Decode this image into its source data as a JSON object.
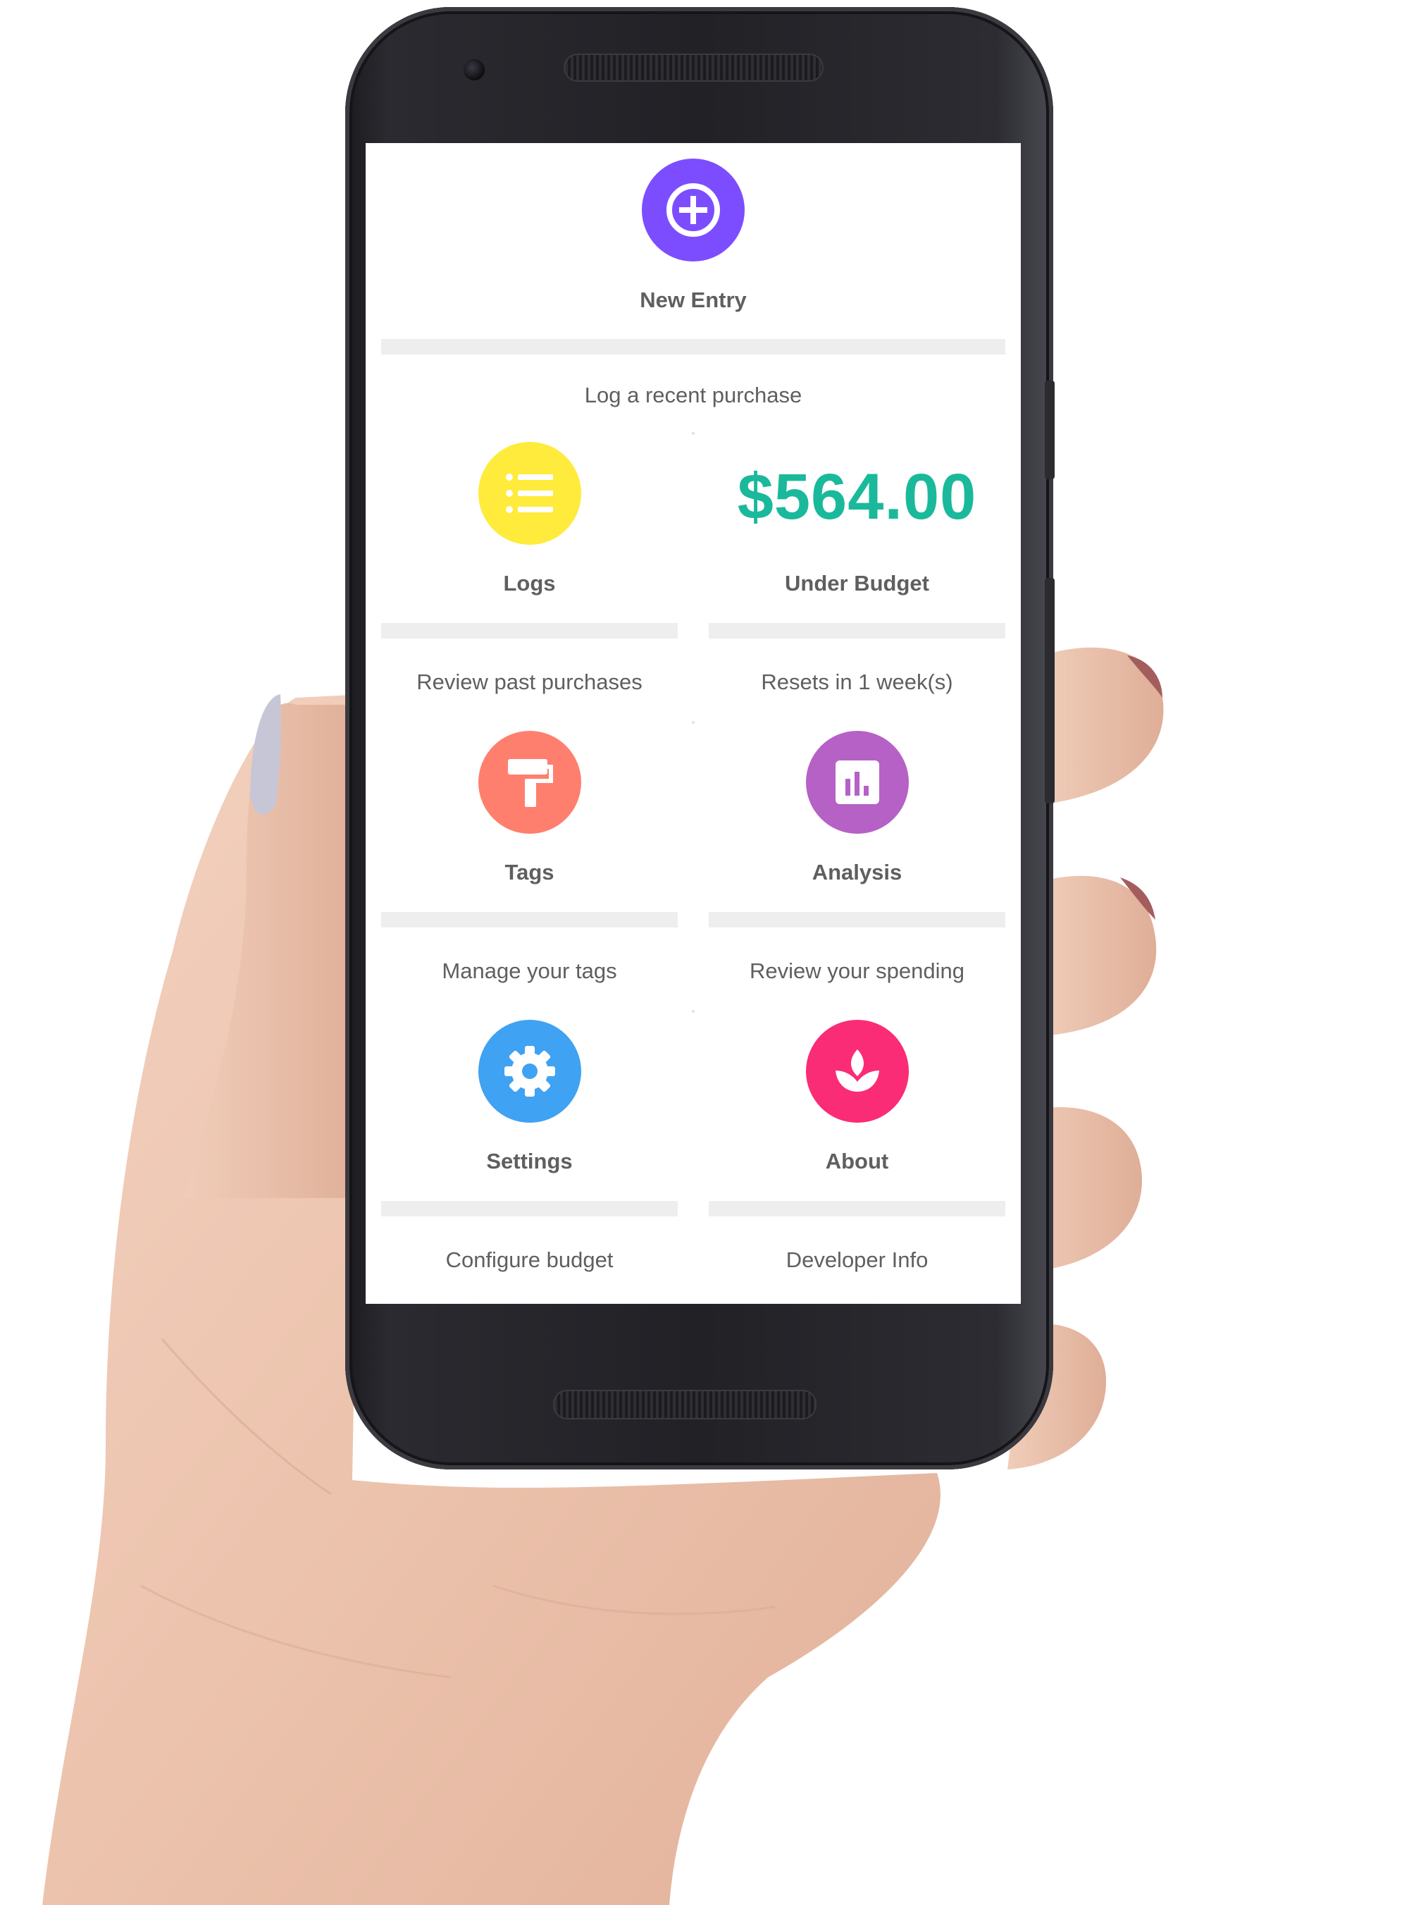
{
  "app": {
    "accent": "#7c4dff",
    "money_color": "#1ab99b"
  },
  "new_entry": {
    "icon": "plus-circle-icon",
    "color": "#7c4dff",
    "label": "New Entry",
    "subtitle": "Log a recent purchase"
  },
  "tiles": [
    {
      "key": "logs",
      "icon": "list-icon",
      "color": "#ffeb3b",
      "label": "Logs",
      "subtitle": "Review past purchases"
    },
    {
      "key": "budget",
      "amount": "$564.00",
      "label": "Under Budget",
      "subtitle": "Resets in 1 week(s)"
    },
    {
      "key": "tags",
      "icon": "paint-roller-icon",
      "color": "#ff7f6e",
      "label": "Tags",
      "subtitle": "Manage your tags"
    },
    {
      "key": "analysis",
      "icon": "bar-chart-icon",
      "color": "#b561c6",
      "label": "Analysis",
      "subtitle": "Review your spending"
    },
    {
      "key": "settings",
      "icon": "gear-icon",
      "color": "#3fa2f2",
      "label": "Settings",
      "subtitle": "Configure budget"
    },
    {
      "key": "about",
      "icon": "lotus-icon",
      "color": "#fa2c75",
      "label": "About",
      "subtitle": "Developer Info"
    }
  ]
}
